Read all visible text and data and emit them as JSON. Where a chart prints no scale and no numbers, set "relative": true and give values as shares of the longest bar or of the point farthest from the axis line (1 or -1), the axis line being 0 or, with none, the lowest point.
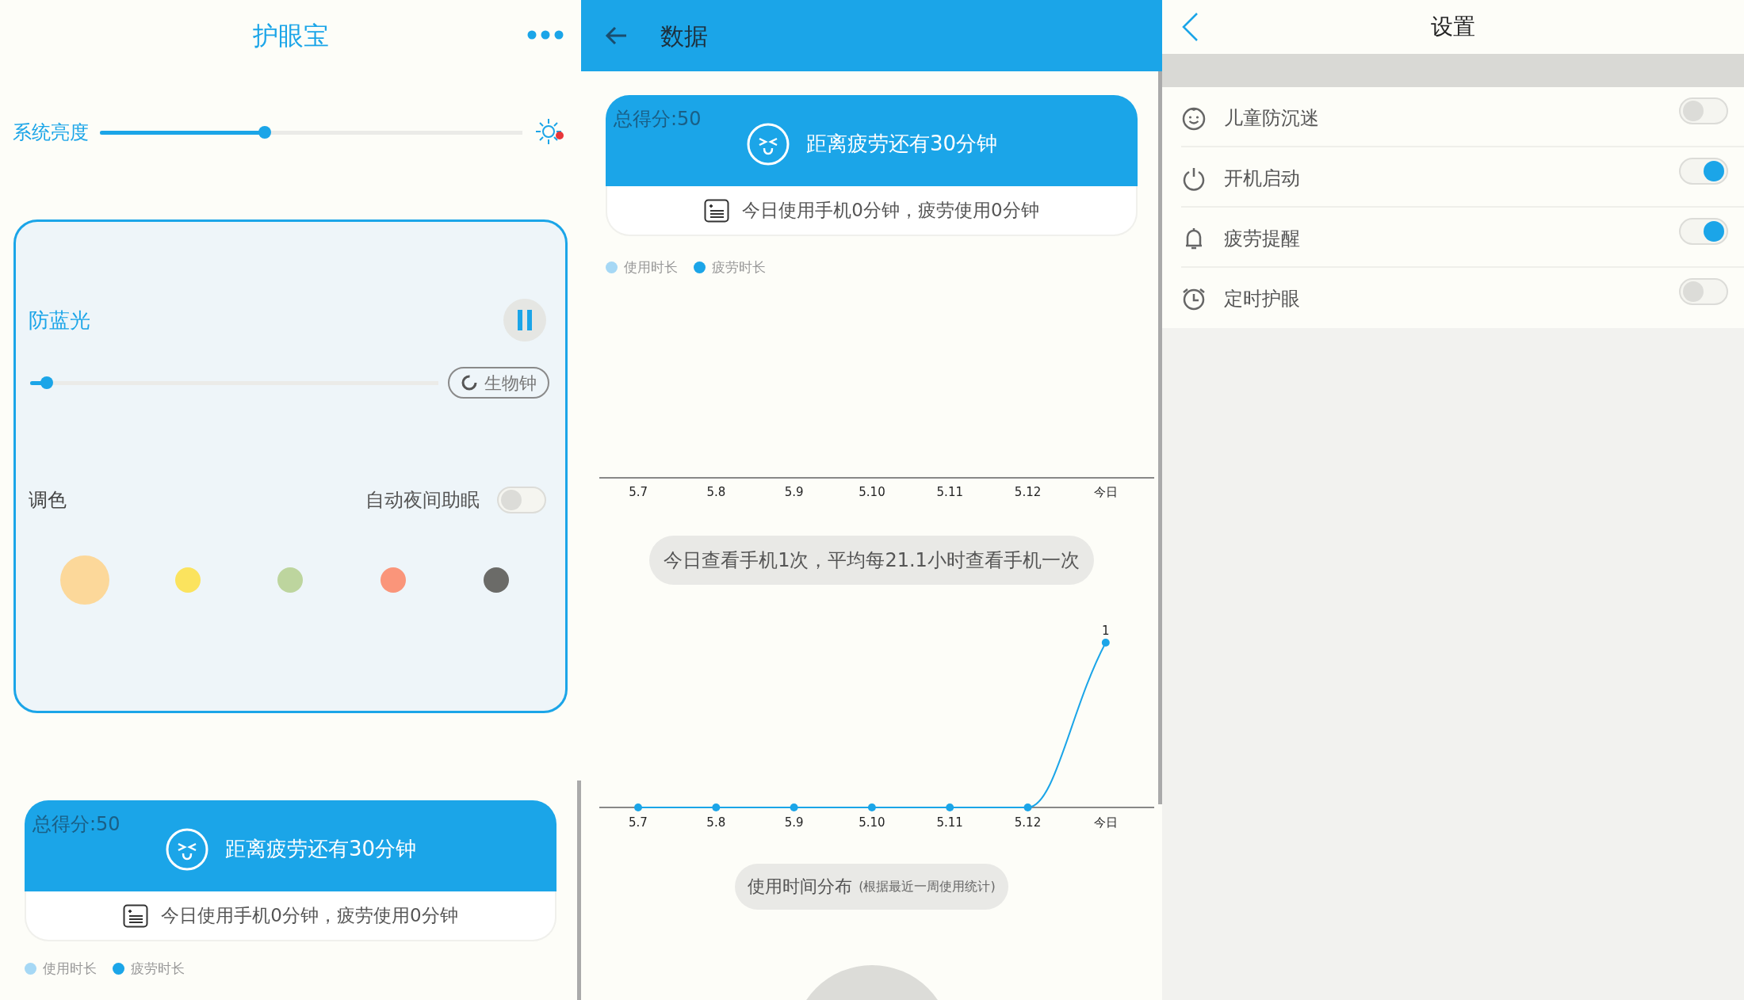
{
  "main_screen": {
    "title": "护眼宝",
    "brightness": {
      "label": "系统亮度",
      "level": 0.39
    },
    "blue_light": {
      "title": "防蓝光",
      "level": 0.04,
      "bio_clock_button": "生物钟"
    },
    "tint": {
      "label": "调色",
      "auto_night": {
        "label": "自动夜间助眠",
        "on": false
      },
      "colors": [
        {
          "color": "#fcd89a",
          "selected": true
        },
        {
          "color": "#fbe35e",
          "selected": false
        },
        {
          "color": "#bdd59e",
          "selected": false
        },
        {
          "color": "#fa957a",
          "selected": false
        },
        {
          "color": "#6b6b68",
          "selected": false
        }
      ]
    },
    "score_card": {
      "score": "总得分:50",
      "message": "距离疲劳还有30分钟",
      "usage": "今日使用手机0分钟，疲劳使用0分钟"
    },
    "legend": [
      {
        "label": "使用时长",
        "color": "#a6d8f5"
      },
      {
        "label": "疲劳时长",
        "color": "#1ba5e8"
      }
    ]
  },
  "data_screen": {
    "title": "数据",
    "score_card": {
      "score": "总得分:50",
      "message": "距离疲劳还有30分钟",
      "usage": "今日使用手机0分钟，疲劳使用0分钟"
    },
    "legend": [
      {
        "label": "使用时长",
        "color": "#a6d8f5"
      },
      {
        "label": "疲劳时长",
        "color": "#1ba5e8"
      }
    ],
    "usage_chart": {
      "x_labels": [
        "5.7",
        "5.8",
        "5.9",
        "5.10",
        "5.11",
        "5.12",
        "今日"
      ]
    },
    "check_summary": "今日查看手机1次，平均每21.1小时查看手机一次",
    "check_chart": {
      "chart_data": {
        "type": "line",
        "categories": [
          "5.7",
          "5.8",
          "5.9",
          "5.10",
          "5.11",
          "5.12",
          "今日"
        ],
        "relative": true,
        "series": [
          {
            "color": "#1ba5e8",
            "marker": true,
            "values": [
              0,
              0,
              0,
              0,
              0,
              0,
              1
            ]
          }
        ],
        "value_labels": [
          null,
          null,
          null,
          null,
          null,
          null,
          "1"
        ]
      }
    },
    "distribution_title": "使用时间分布",
    "distribution_note": "(根据最近一周使用统计)"
  },
  "settings_screen": {
    "title": "设置",
    "items": [
      {
        "label": "儿童防沉迷",
        "on": false
      },
      {
        "label": "开机启动",
        "on": true
      },
      {
        "label": "疲劳提醒",
        "on": true
      },
      {
        "label": "定时护眼",
        "on": false
      }
    ]
  }
}
